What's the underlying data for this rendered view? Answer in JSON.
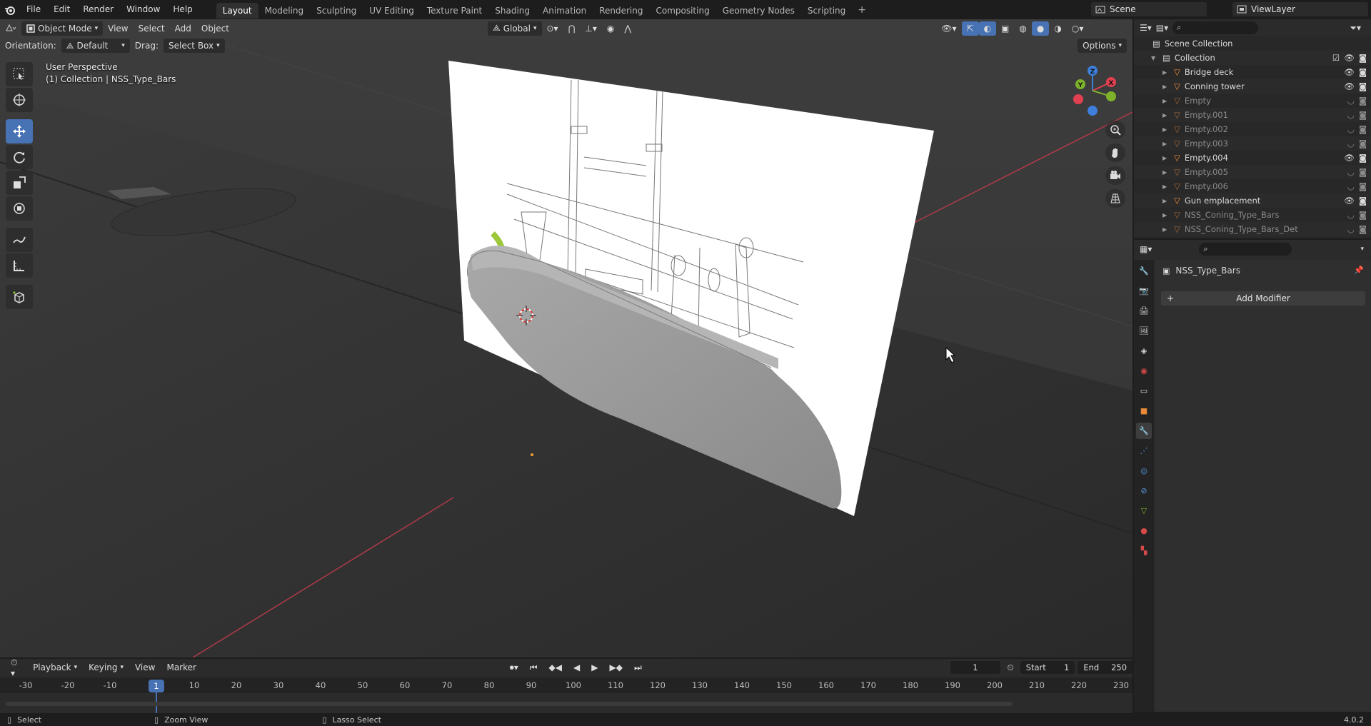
{
  "topbar": {
    "menus": [
      "File",
      "Edit",
      "Render",
      "Window",
      "Help"
    ],
    "workspaces": [
      "Layout",
      "Modeling",
      "Sculpting",
      "UV Editing",
      "Texture Paint",
      "Shading",
      "Animation",
      "Rendering",
      "Compositing",
      "Geometry Nodes",
      "Scripting"
    ],
    "active_workspace": "Layout",
    "scene": "Scene",
    "view_layer": "ViewLayer"
  },
  "viewport": {
    "mode": "Object Mode",
    "menus": [
      "View",
      "Select",
      "Add",
      "Object"
    ],
    "transform_orientation": "Global",
    "orientation_label": "Orientation:",
    "orientation_value": "Default",
    "drag_label": "Drag:",
    "drag_value": "Select Box",
    "options_label": "Options",
    "perspective_text": "User Perspective",
    "collection_text": "(1) Collection | NSS_Type_Bars",
    "gizmo": {
      "x": "X",
      "y": "Y",
      "z": "Z"
    }
  },
  "outliner": {
    "root": "Scene Collection",
    "collection": "Collection",
    "items": [
      {
        "name": "Bridge deck",
        "dim": false
      },
      {
        "name": "Conning tower",
        "dim": false
      },
      {
        "name": "Empty",
        "dim": true
      },
      {
        "name": "Empty.001",
        "dim": true
      },
      {
        "name": "Empty.002",
        "dim": true
      },
      {
        "name": "Empty.003",
        "dim": true
      },
      {
        "name": "Empty.004",
        "dim": false
      },
      {
        "name": "Empty.005",
        "dim": true
      },
      {
        "name": "Empty.006",
        "dim": true
      },
      {
        "name": "Gun emplacement",
        "dim": false
      },
      {
        "name": "NSS_Coning_Type_Bars",
        "dim": true
      },
      {
        "name": "NSS_Coning_Type_Bars_Det",
        "dim": true
      }
    ]
  },
  "properties": {
    "object_name": "NSS_Type_Bars",
    "add_modifier": "Add Modifier"
  },
  "timeline": {
    "menus": [
      "Playback",
      "Keying",
      "View",
      "Marker"
    ],
    "current_frame": "1",
    "start_label": "Start",
    "start": "1",
    "end_label": "End",
    "end": "250",
    "ticks": [
      "-30",
      "-20",
      "-10",
      "10",
      "20",
      "30",
      "40",
      "50",
      "60",
      "70",
      "80",
      "90",
      "100",
      "110",
      "120",
      "130",
      "140",
      "150",
      "160",
      "170",
      "180",
      "190",
      "200",
      "210",
      "220",
      "230"
    ]
  },
  "statusbar": {
    "select": "Select",
    "zoom_view": "Zoom View",
    "lasso_select": "Lasso Select",
    "version": "4.0.2"
  },
  "colors": {
    "accent": "#4772b3",
    "object_orange": "#e88a3a",
    "axis_x": "#e0404f",
    "axis_y": "#7eb22a",
    "axis_z": "#3e7fdc"
  }
}
